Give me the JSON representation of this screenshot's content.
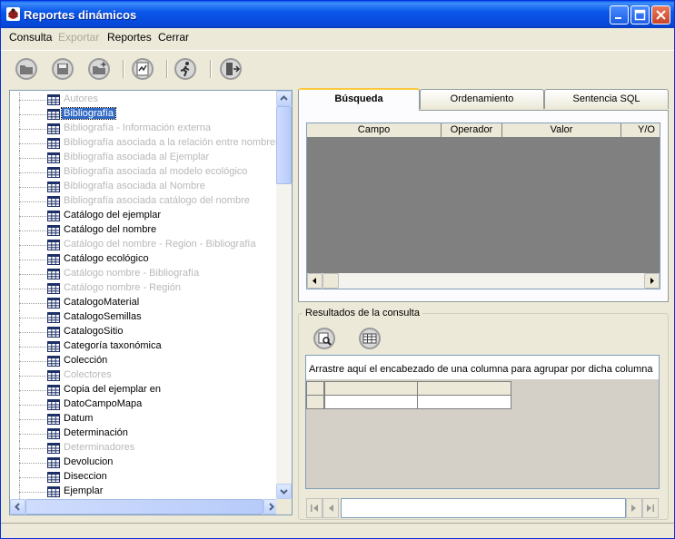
{
  "window": {
    "title": "Reportes dinámicos",
    "controls": [
      "minimize-icon",
      "maximize-icon",
      "close-icon"
    ]
  },
  "menu": {
    "items": [
      {
        "label": "Consulta",
        "enabled": true
      },
      {
        "label": "Exportar",
        "enabled": false
      },
      {
        "label": "Reportes",
        "enabled": true
      },
      {
        "label": "Cerrar",
        "enabled": true
      }
    ]
  },
  "toolbar": {
    "buttons": [
      "open-folder-icon",
      "save-disk-icon",
      "new-folder-icon",
      "report-icon",
      "run-icon",
      "exit-door-icon"
    ]
  },
  "tree": {
    "items": [
      {
        "label": "Autores",
        "enabled": false
      },
      {
        "label": "Bibliografía",
        "enabled": true,
        "selected": true
      },
      {
        "label": "Bibliografía - Información externa",
        "enabled": false
      },
      {
        "label": "Bibliografía asociada a la relación entre nombres",
        "enabled": false
      },
      {
        "label": "Bibliografía asociada al Ejemplar",
        "enabled": false
      },
      {
        "label": "Bibliografía asociada al modelo ecológico",
        "enabled": false
      },
      {
        "label": "Bibliografía asociada al Nombre",
        "enabled": false
      },
      {
        "label": "Bibliografía asociada catálogo del nombre",
        "enabled": false
      },
      {
        "label": "Catálogo del ejemplar",
        "enabled": true
      },
      {
        "label": "Catálogo del nombre",
        "enabled": true
      },
      {
        "label": "Catálogo del nombre - Region - Bibliografía",
        "enabled": false
      },
      {
        "label": "Catálogo ecológico",
        "enabled": true
      },
      {
        "label": "Catálogo nombre - Bibliografía",
        "enabled": false
      },
      {
        "label": "Catálogo nombre - Región",
        "enabled": false
      },
      {
        "label": "CatalogoMaterial",
        "enabled": true
      },
      {
        "label": "CatalogoSemillas",
        "enabled": true
      },
      {
        "label": "CatalogoSitio",
        "enabled": true
      },
      {
        "label": "Categoría taxonómica",
        "enabled": true
      },
      {
        "label": "Colección",
        "enabled": true
      },
      {
        "label": "Colectores",
        "enabled": false
      },
      {
        "label": "Copia del ejemplar en",
        "enabled": true
      },
      {
        "label": "DatoCampoMapa",
        "enabled": true
      },
      {
        "label": "Datum",
        "enabled": true
      },
      {
        "label": "Determinación",
        "enabled": true
      },
      {
        "label": "Determinadores",
        "enabled": false
      },
      {
        "label": "Devolucion",
        "enabled": true
      },
      {
        "label": "Diseccion",
        "enabled": true
      },
      {
        "label": "Ejemplar",
        "enabled": true
      }
    ]
  },
  "tabs": {
    "items": [
      "Búsqueda",
      "Ordenamiento",
      "Sentencia SQL"
    ],
    "active": 0
  },
  "search_grid": {
    "columns": [
      "Campo",
      "Operador",
      "Valor",
      "Y/O"
    ]
  },
  "results": {
    "group_label": "Resultados de la consulta",
    "buttons": [
      "query-preview-icon",
      "table-icon"
    ],
    "drag_hint": "Arrastre aquí el encabezado de una columna para agrupar por dicha columna"
  },
  "navigator": {
    "buttons": [
      "first-record-icon",
      "prev-record-icon",
      "next-record-icon",
      "last-record-icon"
    ]
  }
}
